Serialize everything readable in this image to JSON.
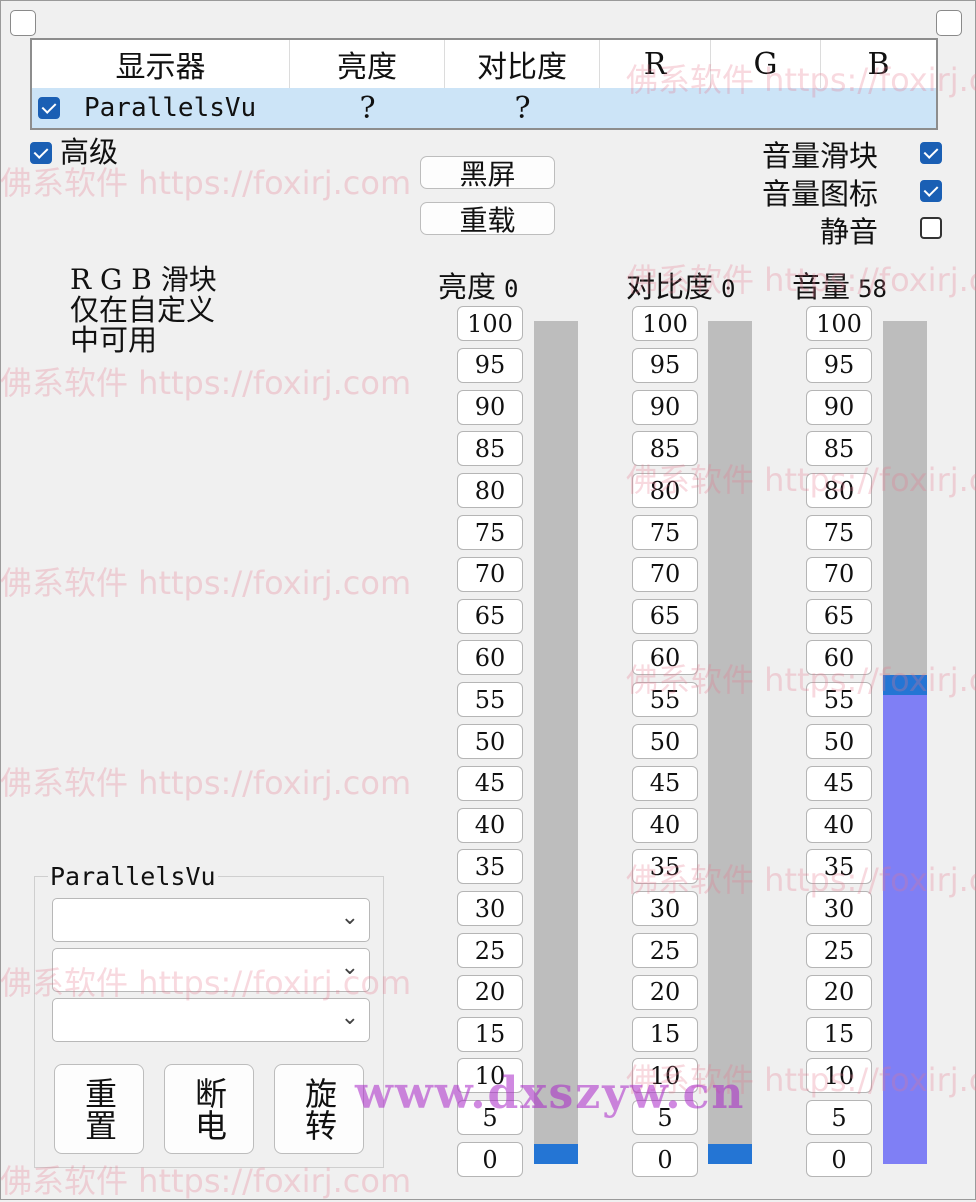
{
  "table": {
    "headers": [
      "显示器",
      "亮度",
      "对比度",
      "R",
      "G",
      "B"
    ],
    "row": {
      "checked": true,
      "monitor": "ParallelsVu",
      "brightness": "?",
      "contrast": "?",
      "r": "",
      "g": "",
      "b": ""
    }
  },
  "advanced": {
    "label": "高级",
    "checked": true
  },
  "buttons": {
    "blackscreen": "黑屏",
    "reload": "重载"
  },
  "options": [
    {
      "label": "音量滑块",
      "checked": true
    },
    {
      "label": "音量图标",
      "checked": true
    },
    {
      "label": "静音",
      "checked": false
    }
  ],
  "rgb_note": [
    "R G B 滑块",
    "仅在自定义",
    "中可用"
  ],
  "sliders": [
    {
      "label": "亮度",
      "value": 0
    },
    {
      "label": "对比度",
      "value": 0
    },
    {
      "label": "音量",
      "value": 58
    }
  ],
  "ticks": [
    "100",
    "95",
    "90",
    "85",
    "80",
    "75",
    "70",
    "65",
    "60",
    "55",
    "50",
    "45",
    "40",
    "35",
    "30",
    "25",
    "20",
    "15",
    "10",
    "5",
    "0"
  ],
  "group": {
    "title": "ParallelsVu",
    "combos": [
      "",
      "",
      ""
    ],
    "buttons": {
      "reset": "重置",
      "poweroff": "断电",
      "rotate": "旋转"
    }
  },
  "watermarks": {
    "foxirj": "佛系软件 https://foxirj.com",
    "dxszyw": "www.dxszyw.cn"
  },
  "colors": {
    "accent": "#2475d4",
    "volume_fill": "#7f7ff5",
    "track": "#bdbdbd",
    "selection": "#cce4f7"
  }
}
